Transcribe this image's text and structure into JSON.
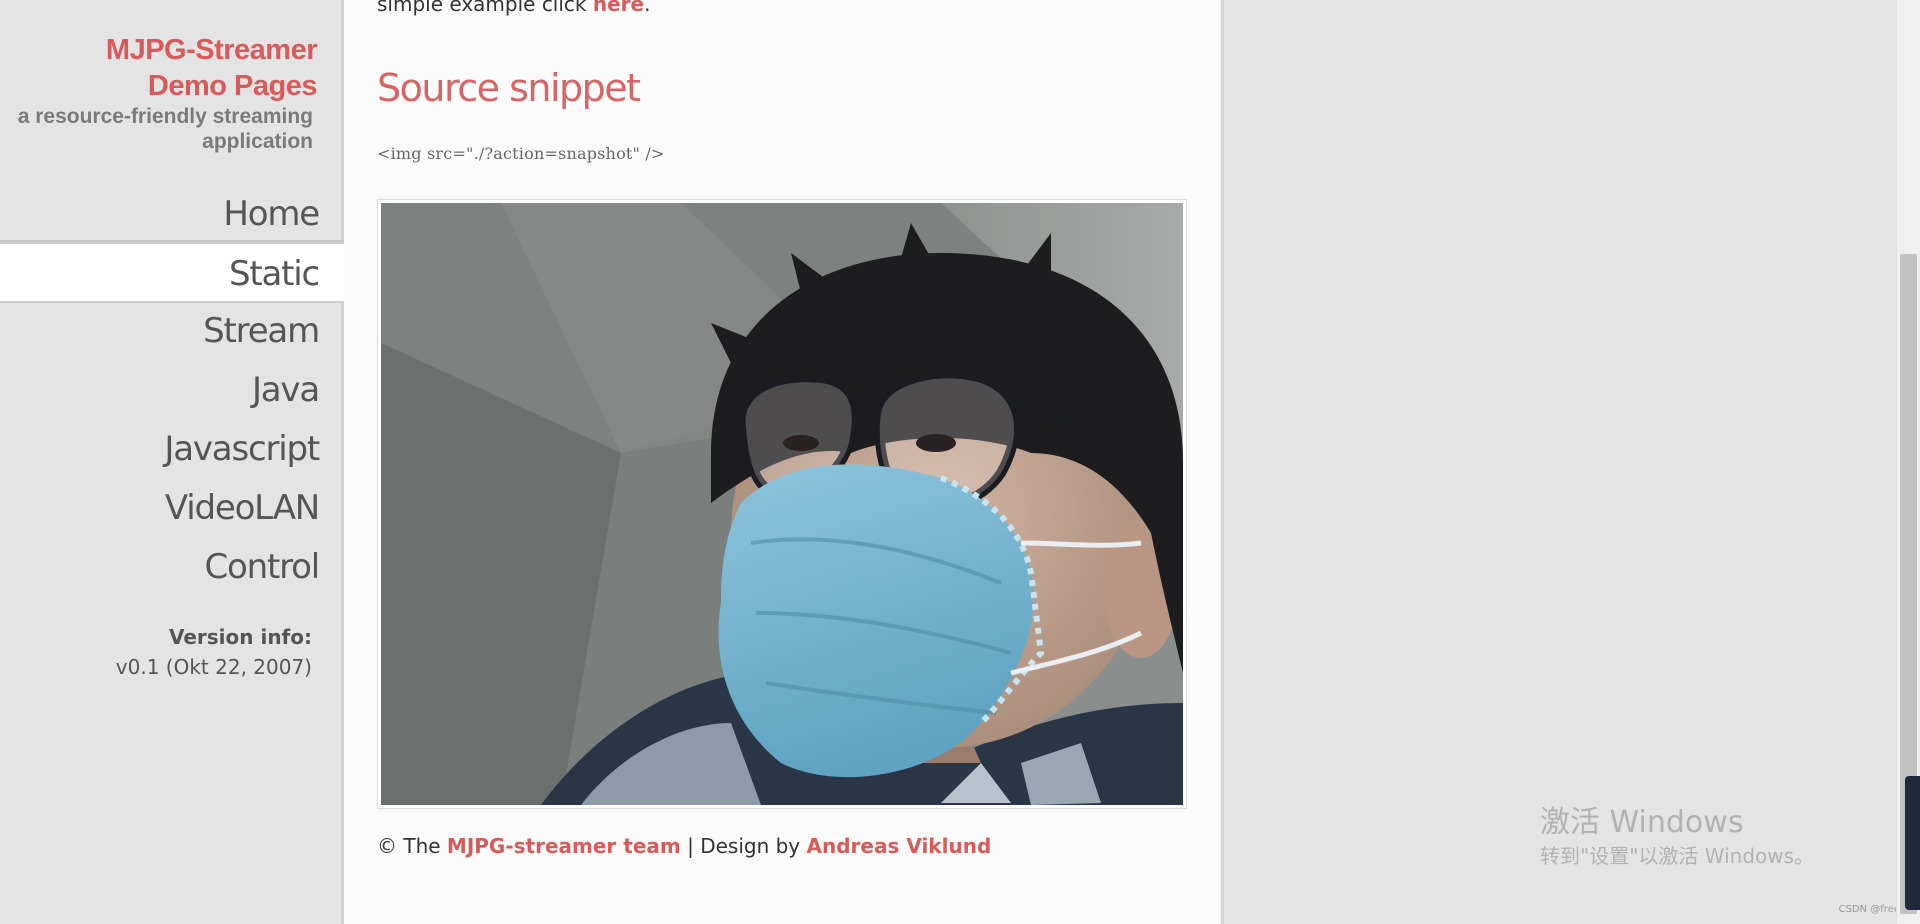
{
  "sidebar": {
    "brand_title_line1": "MJPG-Streamer",
    "brand_title_line2": "Demo Pages",
    "brand_subtitle": "a resource-friendly streaming application",
    "nav": [
      {
        "label": "Home"
      },
      {
        "label": "Static"
      },
      {
        "label": "Stream"
      },
      {
        "label": "Java"
      },
      {
        "label": "Javascript"
      },
      {
        "label": "VideoLAN"
      },
      {
        "label": "Control"
      }
    ],
    "active_nav": "Static",
    "version_label": "Version info:",
    "version_value": "v0.1 (Okt 22, 2007)"
  },
  "main": {
    "intro_text": "simple example click ",
    "intro_link": "here",
    "intro_end": ".",
    "section_title": "Source snippet",
    "code_snippet": "<img src=\"./?action=snapshot\" />",
    "footer_copyright": "© The ",
    "footer_team_link": "MJPG-streamer team",
    "footer_sep": " | Design by ",
    "footer_designer_link": "Andreas Viklund"
  },
  "overlay": {
    "windows_watermark_line1": "激活 Windows",
    "windows_watermark_line2": "转到\"设置\"以激活 Windows。",
    "csdn_tag": "CSDN @free"
  },
  "colors": {
    "accent": "#d85a5a",
    "sidebar_bg": "#e4e4e4",
    "content_bg": "#fbfbfb",
    "text": "#333333"
  }
}
